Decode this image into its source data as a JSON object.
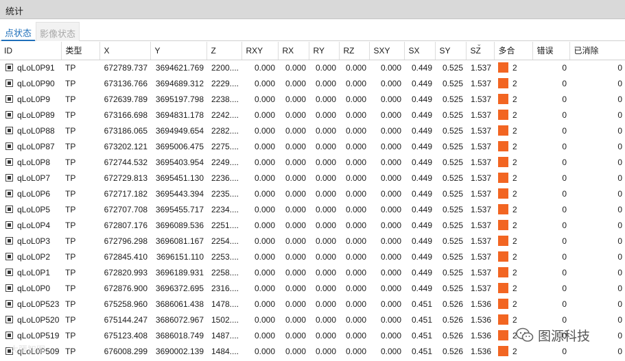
{
  "window": {
    "title": "统计"
  },
  "tabs": [
    {
      "label": "点状态",
      "active": true
    },
    {
      "label": "影像状态",
      "active": false
    }
  ],
  "columns": [
    "ID",
    "类型",
    "X",
    "Y",
    "Z",
    "RXY",
    "RX",
    "RY",
    "RZ",
    "SXY",
    "SX",
    "SY",
    "SZ",
    "多合",
    "错误",
    "已消除"
  ],
  "sorted_column": "SZ",
  "rows": [
    {
      "id": "qLoL0P91",
      "type": "TP",
      "x": "672789.737",
      "y": "3694621.769",
      "z": "2200....",
      "rxy": "0.000",
      "rx": "0.000",
      "ry": "0.000",
      "rz": "0.000",
      "sxy": "0.000",
      "sx": "0.449",
      "sy": "0.525",
      "sz": "1.537",
      "multi": "2",
      "error": "0",
      "removed": "0"
    },
    {
      "id": "qLoL0P90",
      "type": "TP",
      "x": "673136.766",
      "y": "3694689.312",
      "z": "2229....",
      "rxy": "0.000",
      "rx": "0.000",
      "ry": "0.000",
      "rz": "0.000",
      "sxy": "0.000",
      "sx": "0.449",
      "sy": "0.525",
      "sz": "1.537",
      "multi": "2",
      "error": "0",
      "removed": "0"
    },
    {
      "id": "qLoL0P9",
      "type": "TP",
      "x": "672639.789",
      "y": "3695197.798",
      "z": "2238....",
      "rxy": "0.000",
      "rx": "0.000",
      "ry": "0.000",
      "rz": "0.000",
      "sxy": "0.000",
      "sx": "0.449",
      "sy": "0.525",
      "sz": "1.537",
      "multi": "2",
      "error": "0",
      "removed": "0"
    },
    {
      "id": "qLoL0P89",
      "type": "TP",
      "x": "673166.698",
      "y": "3694831.178",
      "z": "2242....",
      "rxy": "0.000",
      "rx": "0.000",
      "ry": "0.000",
      "rz": "0.000",
      "sxy": "0.000",
      "sx": "0.449",
      "sy": "0.525",
      "sz": "1.537",
      "multi": "2",
      "error": "0",
      "removed": "0"
    },
    {
      "id": "qLoL0P88",
      "type": "TP",
      "x": "673186.065",
      "y": "3694949.654",
      "z": "2282....",
      "rxy": "0.000",
      "rx": "0.000",
      "ry": "0.000",
      "rz": "0.000",
      "sxy": "0.000",
      "sx": "0.449",
      "sy": "0.525",
      "sz": "1.537",
      "multi": "2",
      "error": "0",
      "removed": "0"
    },
    {
      "id": "qLoL0P87",
      "type": "TP",
      "x": "673202.121",
      "y": "3695006.475",
      "z": "2275....",
      "rxy": "0.000",
      "rx": "0.000",
      "ry": "0.000",
      "rz": "0.000",
      "sxy": "0.000",
      "sx": "0.449",
      "sy": "0.525",
      "sz": "1.537",
      "multi": "2",
      "error": "0",
      "removed": "0"
    },
    {
      "id": "qLoL0P8",
      "type": "TP",
      "x": "672744.532",
      "y": "3695403.954",
      "z": "2249....",
      "rxy": "0.000",
      "rx": "0.000",
      "ry": "0.000",
      "rz": "0.000",
      "sxy": "0.000",
      "sx": "0.449",
      "sy": "0.525",
      "sz": "1.537",
      "multi": "2",
      "error": "0",
      "removed": "0"
    },
    {
      "id": "qLoL0P7",
      "type": "TP",
      "x": "672729.813",
      "y": "3695451.130",
      "z": "2236....",
      "rxy": "0.000",
      "rx": "0.000",
      "ry": "0.000",
      "rz": "0.000",
      "sxy": "0.000",
      "sx": "0.449",
      "sy": "0.525",
      "sz": "1.537",
      "multi": "2",
      "error": "0",
      "removed": "0"
    },
    {
      "id": "qLoL0P6",
      "type": "TP",
      "x": "672717.182",
      "y": "3695443.394",
      "z": "2235....",
      "rxy": "0.000",
      "rx": "0.000",
      "ry": "0.000",
      "rz": "0.000",
      "sxy": "0.000",
      "sx": "0.449",
      "sy": "0.525",
      "sz": "1.537",
      "multi": "2",
      "error": "0",
      "removed": "0"
    },
    {
      "id": "qLoL0P5",
      "type": "TP",
      "x": "672707.708",
      "y": "3695455.717",
      "z": "2234....",
      "rxy": "0.000",
      "rx": "0.000",
      "ry": "0.000",
      "rz": "0.000",
      "sxy": "0.000",
      "sx": "0.449",
      "sy": "0.525",
      "sz": "1.537",
      "multi": "2",
      "error": "0",
      "removed": "0"
    },
    {
      "id": "qLoL0P4",
      "type": "TP",
      "x": "672807.176",
      "y": "3696089.536",
      "z": "2251....",
      "rxy": "0.000",
      "rx": "0.000",
      "ry": "0.000",
      "rz": "0.000",
      "sxy": "0.000",
      "sx": "0.449",
      "sy": "0.525",
      "sz": "1.537",
      "multi": "2",
      "error": "0",
      "removed": "0"
    },
    {
      "id": "qLoL0P3",
      "type": "TP",
      "x": "672796.298",
      "y": "3696081.167",
      "z": "2254....",
      "rxy": "0.000",
      "rx": "0.000",
      "ry": "0.000",
      "rz": "0.000",
      "sxy": "0.000",
      "sx": "0.449",
      "sy": "0.525",
      "sz": "1.537",
      "multi": "2",
      "error": "0",
      "removed": "0"
    },
    {
      "id": "qLoL0P2",
      "type": "TP",
      "x": "672845.410",
      "y": "3696151.110",
      "z": "2253....",
      "rxy": "0.000",
      "rx": "0.000",
      "ry": "0.000",
      "rz": "0.000",
      "sxy": "0.000",
      "sx": "0.449",
      "sy": "0.525",
      "sz": "1.537",
      "multi": "2",
      "error": "0",
      "removed": "0"
    },
    {
      "id": "qLoL0P1",
      "type": "TP",
      "x": "672820.993",
      "y": "3696189.931",
      "z": "2258....",
      "rxy": "0.000",
      "rx": "0.000",
      "ry": "0.000",
      "rz": "0.000",
      "sxy": "0.000",
      "sx": "0.449",
      "sy": "0.525",
      "sz": "1.537",
      "multi": "2",
      "error": "0",
      "removed": "0"
    },
    {
      "id": "qLoL0P0",
      "type": "TP",
      "x": "672876.900",
      "y": "3696372.695",
      "z": "2316....",
      "rxy": "0.000",
      "rx": "0.000",
      "ry": "0.000",
      "rz": "0.000",
      "sxy": "0.000",
      "sx": "0.449",
      "sy": "0.525",
      "sz": "1.537",
      "multi": "2",
      "error": "0",
      "removed": "0"
    },
    {
      "id": "qLoL0P523",
      "type": "TP",
      "x": "675258.960",
      "y": "3686061.438",
      "z": "1478....",
      "rxy": "0.000",
      "rx": "0.000",
      "ry": "0.000",
      "rz": "0.000",
      "sxy": "0.000",
      "sx": "0.451",
      "sy": "0.526",
      "sz": "1.536",
      "multi": "2",
      "error": "0",
      "removed": "0"
    },
    {
      "id": "qLoL0P520",
      "type": "TP",
      "x": "675144.247",
      "y": "3686072.967",
      "z": "1502....",
      "rxy": "0.000",
      "rx": "0.000",
      "ry": "0.000",
      "rz": "0.000",
      "sxy": "0.000",
      "sx": "0.451",
      "sy": "0.526",
      "sz": "1.536",
      "multi": "2",
      "error": "0",
      "removed": "0"
    },
    {
      "id": "qLoL0P519",
      "type": "TP",
      "x": "675123.408",
      "y": "3686018.749",
      "z": "1487....",
      "rxy": "0.000",
      "rx": "0.000",
      "ry": "0.000",
      "rz": "0.000",
      "sxy": "0.000",
      "sx": "0.451",
      "sy": "0.526",
      "sz": "1.536",
      "multi": "2",
      "error": "0",
      "removed": "0"
    },
    {
      "id": "qLoL0P509",
      "type": "TP",
      "x": "676008.299",
      "y": "3690002.139",
      "z": "1484....",
      "rxy": "0.000",
      "rx": "0.000",
      "ry": "0.000",
      "rz": "0.000",
      "sxy": "0.000",
      "sx": "0.451",
      "sy": "0.526",
      "sz": "1.536",
      "multi": "2",
      "error": "0",
      "removed": "0"
    }
  ],
  "row_icon": "point-checkbox-icon",
  "colors": {
    "multi_swatch": "#f26522",
    "active_tab": "#1e6fba",
    "titlebar": "#d9d9d9"
  },
  "watermark": {
    "left_text": "大疆智图",
    "right_text": "图源科技",
    "right_icon": "wechat-icon"
  }
}
